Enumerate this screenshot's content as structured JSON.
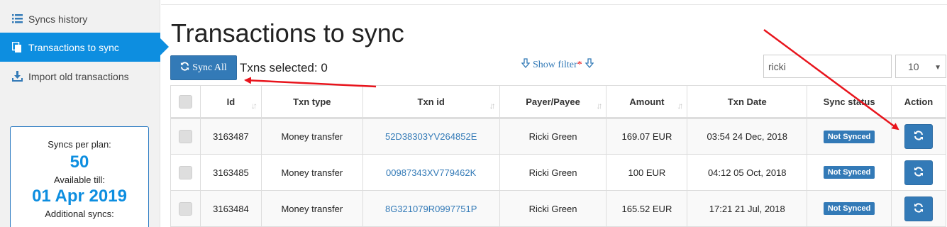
{
  "sidebar": {
    "items": [
      {
        "label": "Syncs history",
        "icon": "list-icon"
      },
      {
        "label": "Transactions to sync",
        "icon": "copy-icon",
        "active": true
      },
      {
        "label": "Import old transactions",
        "icon": "download-icon"
      }
    ],
    "plan": {
      "syncs_label": "Syncs per plan:",
      "syncs_value": "50",
      "available_label": "Available till:",
      "available_value": "01 Apr 2019",
      "additional_label": "Additional syncs:"
    }
  },
  "main": {
    "title": "Transactions to sync",
    "sync_all_label": "Sync All",
    "txns_selected": "Txns selected: 0",
    "show_filter": "Show filter",
    "show_filter_marker": "*",
    "search_value": "ricki",
    "page_size": "10"
  },
  "table": {
    "headers": [
      "Id",
      "Txn type",
      "Txn id",
      "Payer/Payee",
      "Amount",
      "Txn Date",
      "Sync status",
      "Action"
    ],
    "rows": [
      {
        "id": "3163487",
        "type": "Money transfer",
        "txn_id": "52D38303YV264852E",
        "payee": "Ricki Green",
        "amount": "169.07 EUR",
        "date": "03:54 24 Dec, 2018",
        "status": "Not Synced"
      },
      {
        "id": "3163485",
        "type": "Money transfer",
        "txn_id": "00987343XV779462K",
        "payee": "Ricki Green",
        "amount": "100 EUR",
        "date": "04:12 05 Oct, 2018",
        "status": "Not Synced"
      },
      {
        "id": "3163484",
        "type": "Money transfer",
        "txn_id": "8G321079R0997751P",
        "payee": "Ricki Green",
        "amount": "165.52 EUR",
        "date": "17:21 21 Jul, 2018",
        "status": "Not Synced"
      }
    ]
  },
  "colors": {
    "accent": "#0d8ee0",
    "button": "#337ab7",
    "annotation_arrow": "#e8141c"
  }
}
